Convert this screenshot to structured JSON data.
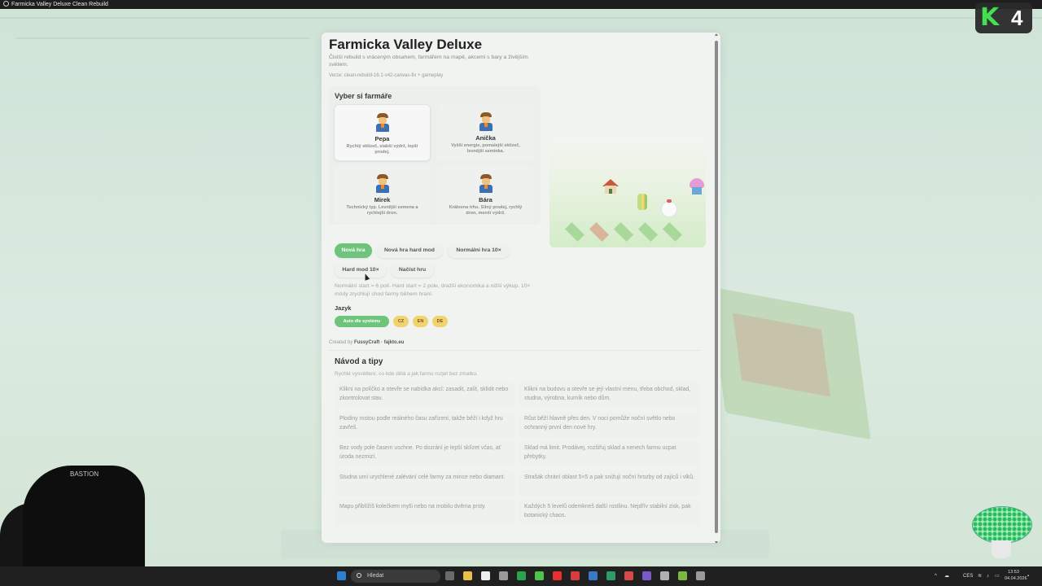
{
  "window": {
    "title": "Farmicka Valley Deluxe Clean Rebuild"
  },
  "overlay": {
    "badge_k": "K",
    "badge_num": "4",
    "cam_label": "BASTION"
  },
  "panel": {
    "title": "Farmicka Valley Deluxe",
    "subtitle": "Čistší rebuild s vráceným obsahem, farmářem na mapě, akcemi s bary a živějším světem.",
    "version": "Verze: clean-rebuild-16.1-v42-canvas-fix + gameplay",
    "farmer_section": {
      "heading": "Vyber si farmáře",
      "farmers": [
        {
          "name": "Pepa",
          "desc": "Rychlý sklízeč, slabší výdrž, lepší prodej."
        },
        {
          "name": "Anička",
          "desc": "Vyšší energie, pomalejší sklízeč, levnější semínka."
        },
        {
          "name": "Mirek",
          "desc": "Technický typ. Levnější semena a rychlejší dron."
        },
        {
          "name": "Bára",
          "desc": "Královna trhu. Silný prodej, rychlý dron, menší výdrž."
        }
      ],
      "selected": "Pepa"
    },
    "buttons": {
      "new_game": "Nová hra",
      "new_game_hard": "Nová hra hard mod",
      "normal_10x": "Normální hra 10×",
      "hard_10x": "Hard mod 10×",
      "load_game": "Načíst hru"
    },
    "mode_note": "Normální start = 6 polí. Hard start = 2 pole, dražší ekonomika a nižší výkup. 10× módy zrychlují chod farmy během hraní.",
    "language": {
      "heading": "Jazyk",
      "options": [
        "Auto dle systému",
        "CZ",
        "EN",
        "DE"
      ],
      "selected": "Auto dle systému"
    },
    "credit_prefix": "Created by",
    "credit_author": "FussyCraft · fajkto.eu",
    "tips": {
      "heading": "Návod a tipy",
      "subtitle": "Rychlé vysvětlení, co kde dělá a jak farmu rozjet bez zmatku.",
      "items": [
        "Klikni na políčko a otevře se nabídka akcí: zasadit, zalít, sklidit nebo zkontrolovat stav.",
        "Klikni na budovu a otevře se její vlastní menu, třeba obchod, sklad, studna, výrobna, kurník nebo dům.",
        "Plodiny rostou podle reálného času zařízení, takže běží i když hru zavřeš.",
        "Růst běží hlavně přes den. V noci pomůže noční světlo nebo ochranný první den nové hry.",
        "Bez vody pole časem uschne. Po dozrání je lepší sklízet včas, ať úroda nezmizí.",
        "Sklad má limit. Prodávej, rozšiřuj sklad a nenech farmu ucpat přebytky.",
        "Studna umí urychlené zalévání celé farmy za mince nebo diamant.",
        "Strašák chrání oblast 5×5 a pak snižují noční hrozby od zajíců i vlků.",
        "Mapu přiblížíš kolečkem myši nebo na mobilu dvěma prsty.",
        "Každých 5 levelů odemkneš další rostlinu. Nejdřív stabilní zisk, pak botanický chaos."
      ]
    }
  },
  "taskbar": {
    "search_placeholder": "Hledat",
    "lang": "CES",
    "time": "13:53",
    "date": "04.04.2026",
    "icon_colors": [
      "#2d7dd2",
      "#6b6b6b",
      "#e8c04a",
      "#eeeeee",
      "#9a9a9a",
      "#2aa34a",
      "#4cc44a",
      "#e83030",
      "#d83c3c",
      "#3a78c8",
      "#2f9a6a",
      "#d84a4a",
      "#7a5ac8",
      "#b0b0b0",
      "#7ab840",
      "#9a9a9a"
    ]
  },
  "colors": {
    "accent_green": "#6fc47c",
    "lang_yellow": "#f0d36e",
    "taskbar": "#202020"
  }
}
